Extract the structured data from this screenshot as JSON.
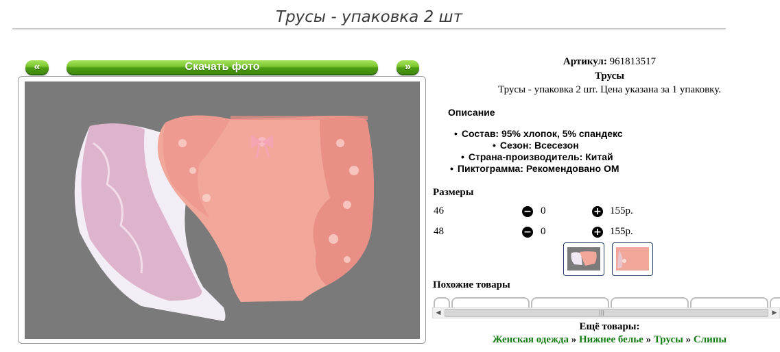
{
  "page": {
    "title": "Трусы - упаковка 2 шт"
  },
  "gallery": {
    "prev_label": "«",
    "download_label": "Скачать фото",
    "next_label": "»"
  },
  "product": {
    "article_label": "Артикул:",
    "article_value": "961813517",
    "name": "Трусы",
    "summary": "Трусы - упаковка 2 шт. Цена указана за 1 упаковку.",
    "description_heading": "Описание",
    "specs": [
      "Состав: 95% хлопок, 5% спандекс",
      "Сезон: Всесезон",
      "Страна-производитель: Китай",
      "Пиктограмма: Рекомендовано ОМ"
    ]
  },
  "sizes": {
    "heading": "Размеры",
    "rows": [
      {
        "size": "46",
        "qty": "0",
        "price": "155р."
      },
      {
        "size": "48",
        "qty": "0",
        "price": "155р."
      }
    ]
  },
  "similar": {
    "heading": "Похожие товары"
  },
  "more": {
    "heading": "Ещё товары:",
    "crumbs": [
      "Женская одежда",
      "Нижнее белье",
      "Трусы",
      "Слипы"
    ],
    "separator": "»"
  },
  "icons": {
    "minus": "minus-circle-icon",
    "plus": "plus-circle-icon"
  },
  "colors": {
    "accent_green": "#7cc631",
    "link_green": "#117c11",
    "photo_bg": "#7a7a7a",
    "peach": "#f1a89a",
    "white_garment": "#f3eef6"
  }
}
